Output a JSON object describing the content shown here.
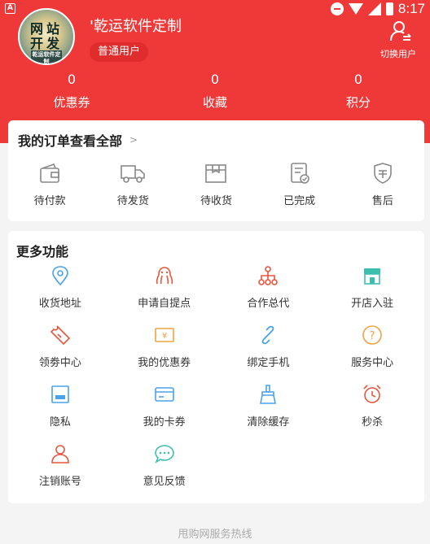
{
  "status_bar": {
    "time": "8:17"
  },
  "user": {
    "avatar_line1": "网站",
    "avatar_line2": "开发",
    "avatar_line3": "乾运软件定制",
    "name": "'乾运软件定制",
    "badge": "普通用户",
    "switch_label": "切换用户"
  },
  "stats": [
    {
      "value": "0",
      "label": "优惠券"
    },
    {
      "value": "0",
      "label": "收藏"
    },
    {
      "value": "0",
      "label": "积分"
    }
  ],
  "orders": {
    "title": "我的订单查看全部",
    "arrow": ">",
    "items": [
      {
        "label": "待付款",
        "icon": "wallet-icon"
      },
      {
        "label": "待发货",
        "icon": "truck-icon"
      },
      {
        "label": "待收货",
        "icon": "package-icon"
      },
      {
        "label": "已完成",
        "icon": "checklist-icon"
      },
      {
        "label": "售后",
        "icon": "shield-icon"
      }
    ]
  },
  "more": {
    "title": "更多功能",
    "items": [
      {
        "label": "收货地址",
        "icon": "location-icon",
        "color": "#4aa3e8"
      },
      {
        "label": "申请自提点",
        "icon": "octopus-icon",
        "color": "#e8553b"
      },
      {
        "label": "合作总代",
        "icon": "network-icon",
        "color": "#e8553b"
      },
      {
        "label": "开店入驻",
        "icon": "store-icon",
        "color": "#3cbfae"
      },
      {
        "label": "领劵中心",
        "icon": "ticket-icon",
        "color": "#e8553b"
      },
      {
        "label": "我的优惠券",
        "icon": "coupon-icon",
        "color": "#f0a23c"
      },
      {
        "label": "绑定手机",
        "icon": "link-icon",
        "color": "#4aa3e8"
      },
      {
        "label": "服务中心",
        "icon": "question-icon",
        "color": "#f0a23c"
      },
      {
        "label": "隐私",
        "icon": "privacy-icon",
        "color": "#4aa3e8"
      },
      {
        "label": "我的卡券",
        "icon": "card-icon",
        "color": "#4aa3e8"
      },
      {
        "label": "清除缓存",
        "icon": "broom-icon",
        "color": "#4aa3e8"
      },
      {
        "label": "秒杀",
        "icon": "alarm-icon",
        "color": "#e8553b"
      },
      {
        "label": "注销账号",
        "icon": "user-icon",
        "color": "#e8553b"
      },
      {
        "label": "意见反馈",
        "icon": "chat-icon",
        "color": "#3cbfae"
      }
    ]
  },
  "footer": {
    "text": "甩购网服务热线"
  },
  "colors": {
    "brand_red": "#ef3838",
    "badge_red": "#e02c2c",
    "background": "#f4f4f4"
  }
}
